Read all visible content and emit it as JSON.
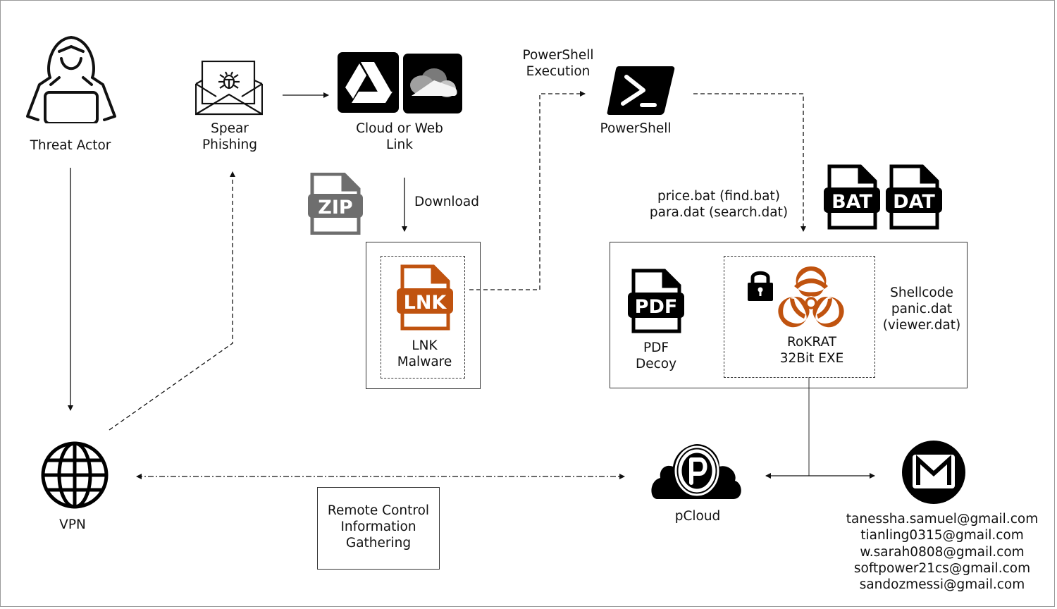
{
  "diagram": {
    "nodes": {
      "threat_actor": {
        "label": "Threat Actor",
        "icon": "hacker-icon"
      },
      "spear_phishing": {
        "label": "Spear\nPhishing",
        "icon": "malicious-email-icon"
      },
      "cloud_link": {
        "label": "Cloud or Web\nLink",
        "icons": [
          "google-drive-icon",
          "onedrive-icon"
        ]
      },
      "powershell": {
        "label": "PowerShell",
        "icon": "powershell-icon"
      },
      "zip": {
        "icon": "zip-file-icon",
        "badge": "ZIP"
      },
      "lnk_malware": {
        "label": "LNK\nMalware",
        "icon": "lnk-file-icon",
        "badge": "LNK"
      },
      "bat_file": {
        "icon": "bat-file-icon",
        "badge": "BAT"
      },
      "dat_file": {
        "icon": "dat-file-icon",
        "badge": "DAT"
      },
      "pdf_decoy": {
        "label": "PDF\nDecoy",
        "icon": "pdf-file-icon",
        "badge": "PDF"
      },
      "rokrat": {
        "label": "RoKRAT\n32Bit EXE",
        "icons": [
          "lock-icon",
          "biohazard-icon"
        ]
      },
      "shellcode": {
        "label": "Shellcode\npanic.dat\n(viewer.dat)"
      },
      "vpn": {
        "label": "VPN",
        "icon": "globe-icon"
      },
      "pcloud": {
        "label": "pCloud",
        "icon": "pcloud-icon"
      },
      "gmail": {
        "icon": "gmail-icon",
        "emails": [
          "tanessha.samuel@gmail.com",
          "tianling0315@gmail.com",
          "w.sarah0808@gmail.com",
          "softpower21cs@gmail.com",
          "sandozmessi@gmail.com"
        ]
      }
    },
    "edge_labels": {
      "download": "Download",
      "powershell_execution": "PowerShell\nExecution",
      "dropped_files": "price.bat (find.bat)\npara.dat (search.dat)",
      "remote_control": "Remote Control\nInformation\nGathering"
    },
    "colors": {
      "accent": "#c0530f",
      "zip_gray": "#6e6e6e",
      "line": "#111111",
      "frame": "#9a9a9a"
    }
  }
}
